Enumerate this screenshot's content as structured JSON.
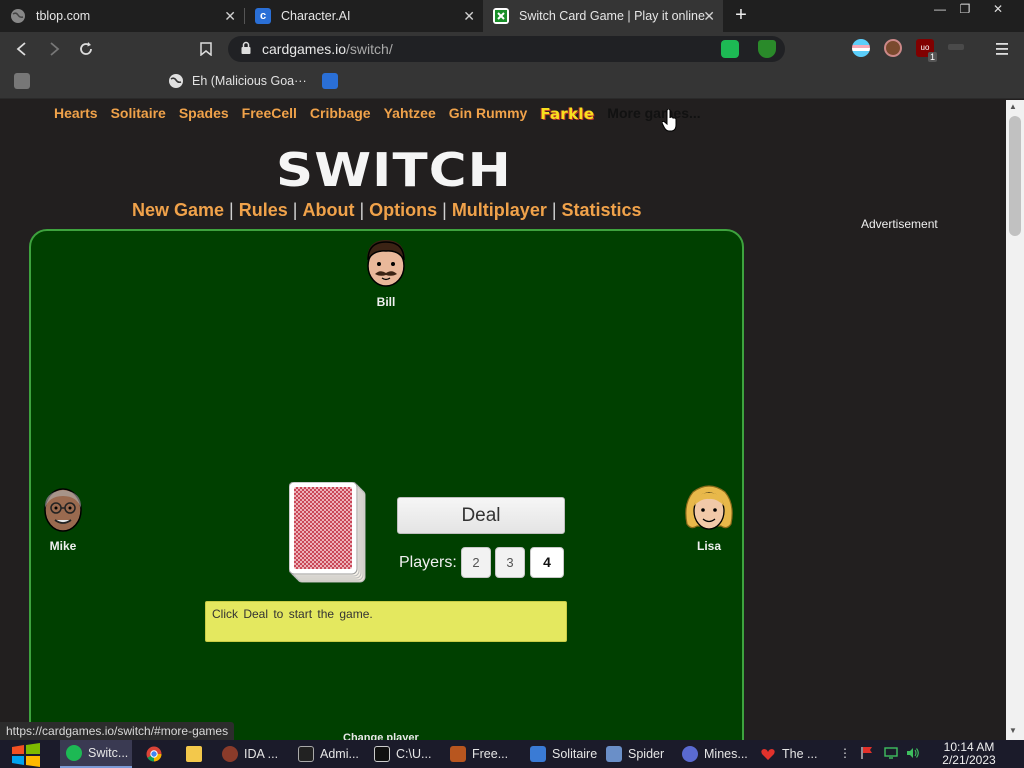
{
  "browser": {
    "tabs": [
      {
        "title": "tblop.com",
        "active": false
      },
      {
        "title": "Character.AI",
        "active": false
      },
      {
        "title": "Switch Card Game | Play it online",
        "active": true
      }
    ],
    "new_tab_symbol": "+",
    "window_controls": {
      "minimize": "—",
      "restore": "❐",
      "close": "✕"
    },
    "url": {
      "domain": "cardgames.io",
      "path": "/switch/"
    },
    "bookmarks": [
      {
        "label": "",
        "icon": "bookmark-icon-1"
      },
      {
        "label": "Eh (Malicious Goa···",
        "icon": "globe-icon"
      },
      {
        "label": "",
        "icon": "bookmark-icon-3"
      }
    ],
    "extension_badge": "1"
  },
  "site": {
    "game_links": [
      "Hearts",
      "Solitaire",
      "Spades",
      "FreeCell",
      "Cribbage",
      "Yahtzee",
      "Gin Rummy",
      "Farkle",
      "More games..."
    ],
    "logo": "SWITCH",
    "menu": [
      "New Game",
      "Rules",
      "About",
      "Options",
      "Multiplayer",
      "Statistics"
    ],
    "menu_separator": "|",
    "advertisement": "Advertisement"
  },
  "game": {
    "players": {
      "top": "Bill",
      "left": "Mike",
      "right": "Lisa"
    },
    "deal_button": "Deal",
    "players_label": "Players:",
    "player_counts": [
      "2",
      "3",
      "4"
    ],
    "selected_player_count": "4",
    "message": "Click Deal to start the game.",
    "change_player": "Change player"
  },
  "status_url": "https://cardgames.io/switch/#more-games",
  "taskbar": {
    "items": [
      {
        "label": "Switc...",
        "icon": "spotify-icon",
        "active": true
      },
      {
        "label": "",
        "icon": "chrome-icon",
        "active": false
      },
      {
        "label": "",
        "icon": "folder-icon",
        "active": false
      },
      {
        "label": "IDA ...",
        "icon": "ida-icon",
        "active": false
      },
      {
        "label": "Admi...",
        "icon": "terminal-icon",
        "active": false
      },
      {
        "label": "C:\\U...",
        "icon": "cmd-icon",
        "active": false
      },
      {
        "label": "Free...",
        "icon": "freecell-icon",
        "active": false
      },
      {
        "label": "Solitaire",
        "icon": "solitaire-icon",
        "active": false
      },
      {
        "label": "Spider",
        "icon": "spider-icon",
        "active": false
      },
      {
        "label": "Mines...",
        "icon": "minesweeper-icon",
        "active": false
      },
      {
        "label": "The ...",
        "icon": "hearts-icon",
        "active": false
      }
    ],
    "time": "10:14 AM",
    "date": "2/21/2023"
  },
  "colors": {
    "link_orange": "#f0a24a",
    "felt_green": "#004000",
    "felt_border": "#3ea33e",
    "message_yellow": "#e4e85f"
  }
}
